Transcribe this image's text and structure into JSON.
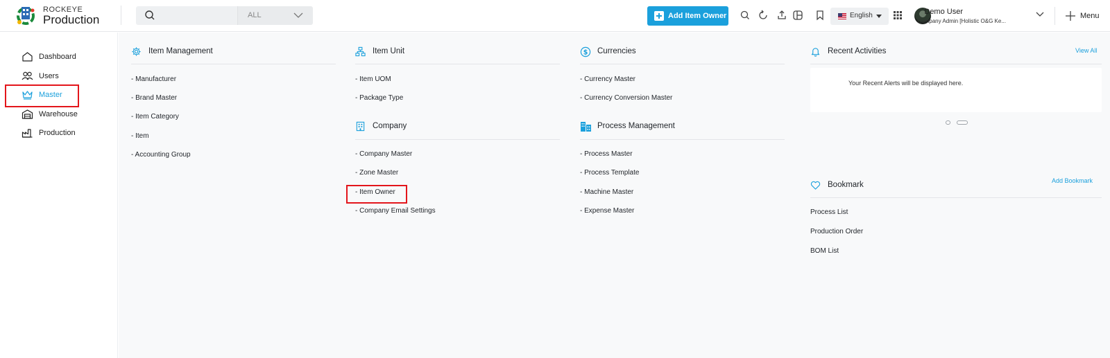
{
  "app": {
    "brand_top": "ROCKEYE",
    "brand_main": "Production"
  },
  "search": {
    "placeholder": "",
    "filter_value": "ALL"
  },
  "header": {
    "add_button_label": "Add Item Owner",
    "language": "English",
    "user_name": "Demo User",
    "user_role": "Company Admin [Holistic O&G Ke...",
    "menu_label": "Menu",
    "icons": [
      "search-icon",
      "refresh-icon",
      "upload-icon",
      "grid-table-icon",
      "bookmark-icon",
      "apps-icon"
    ]
  },
  "sidebar": {
    "items": [
      {
        "label": "Dashboard",
        "icon": "home-icon"
      },
      {
        "label": "Users",
        "icon": "users-icon"
      },
      {
        "label": "Master",
        "icon": "crown-icon"
      },
      {
        "label": "Warehouse",
        "icon": "warehouse-icon"
      },
      {
        "label": "Production",
        "icon": "factory-icon"
      }
    ]
  },
  "sections": {
    "item_management": {
      "title": "Item Management",
      "links": [
        "- Manufacturer",
        "- Brand Master",
        "- Item Category",
        "- Item",
        "- Accounting Group"
      ]
    },
    "item_unit": {
      "title": "Item Unit",
      "links": [
        "- Item UOM",
        "- Package Type"
      ]
    },
    "company": {
      "title": "Company",
      "links": [
        "- Company Master",
        "- Zone Master",
        "- Item Owner",
        "- Company Email Settings"
      ]
    },
    "currencies": {
      "title": "Currencies",
      "links": [
        "- Currency Master",
        "- Currency Conversion Master"
      ]
    },
    "process_management": {
      "title": "Process Management",
      "links": [
        "- Process Master",
        "- Process Template",
        "- Machine Master",
        "- Expense Master"
      ]
    }
  },
  "recent": {
    "title": "Recent Activities",
    "view_all": "View All",
    "empty_text": "Your Recent Alerts will be displayed here."
  },
  "bookmark": {
    "title": "Bookmark",
    "add_label": "Add Bookmark",
    "items": [
      "Process List",
      "Production Order",
      "BOM List"
    ]
  },
  "colors": {
    "accent": "#1ba0dc",
    "highlight": "#e3151b"
  }
}
